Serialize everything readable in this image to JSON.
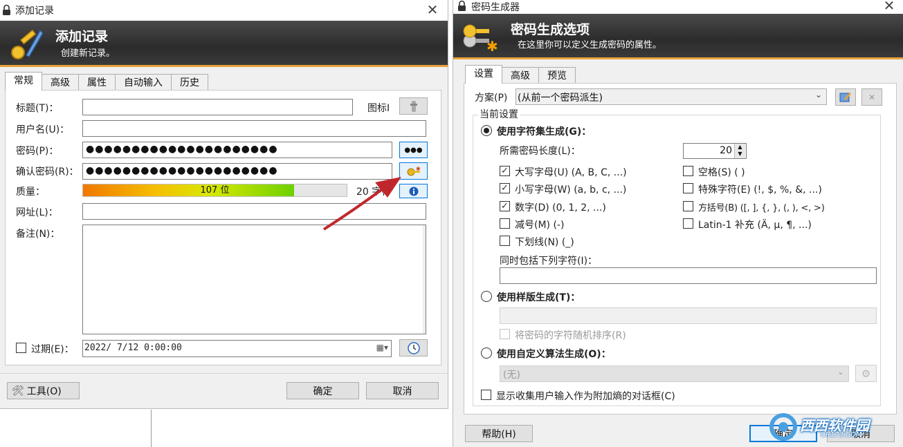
{
  "left": {
    "title": "添加记录",
    "banner_title": "添加记录",
    "banner_subtitle": "创建新记录。",
    "tabs": [
      "常规",
      "高级",
      "属性",
      "自动输入",
      "历史"
    ],
    "labels": {
      "title": "标题(T)：",
      "icon": "图标I",
      "username": "用户名(U)：",
      "password": "密码(P)：",
      "repeat": "确认密码(R)：",
      "quality": "质量：",
      "url": "网址(L)：",
      "notes": "备注(N)：",
      "expires": "过期(E)："
    },
    "password_dots": "●●●●●●●●●●●●●●●●●●●●●",
    "repeat_dots": "●●●●●●●●●●●●●●●●●●●●●",
    "show_pw_button": "●●●",
    "quality_bits": "107 位",
    "quality_fraction": 0.8,
    "char_count": "20 字符",
    "expiry_value": "2022/ 7/12   0:00:00",
    "tools_button": "工具(O)",
    "ok_button": "确定",
    "cancel_button": "取消"
  },
  "right": {
    "title": "密码生成器",
    "banner_title": "密码生成选项",
    "banner_subtitle": "在这里你可以定义生成密码的属性。",
    "tabs": [
      "设置",
      "高级",
      "预览"
    ],
    "profile_label": "方案(P)",
    "profile_value": "(从前一个密码派生)",
    "current_settings": "当前设置",
    "charset_radio": "使用字符集生成(G)：",
    "length_label": "所需密码长度(L)：",
    "length_value": "20",
    "options": {
      "upper": "大写字母(U)  (A, B, C, ...)",
      "lower": "小写字母(W)  (a, b, c, ...)",
      "digits": "数字(D)  (0, 1, 2, ...)",
      "minus": "减号(M)  (-)",
      "underline": "下划线(N)  (_)",
      "space": "空格(S)  ( )",
      "special": "特殊字符(E)  (!, $, %, &, ...)",
      "brackets": "方括号(B)  ([, ], {, }, (, ), <, >)",
      "latin1": "Latin-1 补充  (Ä, µ, ¶, ...)"
    },
    "also_include": "同时包括下列字符(I)：",
    "pattern_radio": "使用样版生成(T)：",
    "permute": "将密码的字符随机排序(R)",
    "custom_radio": "使用自定义算法生成(O)：",
    "custom_value": "(无)",
    "entropy": "显示收集用户输入作为附加熵的对话框(C)",
    "help_button": "帮助(H)",
    "ok_button": "确定",
    "cancel_button": "取消"
  },
  "watermark": {
    "brand": "西西软件园",
    "domain": "CR173.COM"
  },
  "colors": {
    "banner": "#333333",
    "accent": "#e8a23a",
    "arrow": "#c0272d",
    "focus": "#0078d7"
  }
}
